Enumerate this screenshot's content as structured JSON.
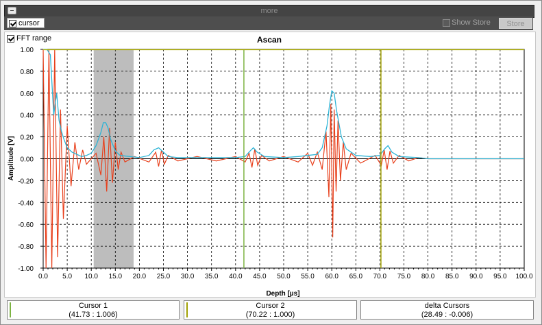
{
  "header": {
    "more_label": "more"
  },
  "toolbar": {
    "cursor_label": "cursor",
    "cursor_checked": true,
    "show_store_label": "Show Store",
    "show_store_checked": false,
    "store_label": "Store"
  },
  "fft_range": {
    "label": "FFT range",
    "checked": true
  },
  "readouts": [
    {
      "title": "Cursor 1",
      "value": "(41.73 : 1.006)",
      "color": "#7cb342"
    },
    {
      "title": "Cursor 2",
      "value": "(70.22 : 1.000)",
      "color": "#a0a000"
    },
    {
      "title": "delta Cursors",
      "value": "(28.49 : -0.006)"
    }
  ],
  "colors": {
    "signal": "#e8401c",
    "envelope": "#2db4d6",
    "cursor1": "#7cb342",
    "cursor2": "#a0a000",
    "fft_band": "#bdbdbd"
  },
  "chart_data": {
    "type": "line",
    "title": "Ascan",
    "xlabel": "Depth [µs]",
    "ylabel": "Amplitude [V]",
    "xlim": [
      0,
      100
    ],
    "ylim": [
      -1,
      1
    ],
    "x_ticks": [
      "0.0",
      "5.0",
      "10.0",
      "15.0",
      "20.0",
      "25.0",
      "30.0",
      "35.0",
      "40.0",
      "45.0",
      "50.0",
      "55.0",
      "60.0",
      "65.0",
      "70.0",
      "75.0",
      "80.0",
      "85.0",
      "90.0",
      "95.0",
      "100.0"
    ],
    "y_ticks": [
      "1.00",
      "0.80",
      "0.60",
      "0.40",
      "0.20",
      "0.00",
      "-0.20",
      "-0.40",
      "-0.60",
      "-0.80",
      "-1.00"
    ],
    "grid": true,
    "fft_range": [
      10.5,
      18.8
    ],
    "cursors": [
      41.73,
      70.22
    ],
    "series": [
      {
        "kind": "envelope",
        "x": [
          0,
          0.8,
          1.5,
          2.2,
          2.8,
          3.3,
          3.8,
          4.3,
          5,
          6,
          7,
          8,
          9,
          10,
          11,
          12,
          12.5,
          13,
          13.5,
          14,
          15,
          16,
          18,
          20,
          22,
          23,
          24,
          25,
          26,
          28,
          30,
          35,
          40,
          42,
          43,
          43.7,
          44.5,
          46,
          50,
          53,
          55,
          57,
          58,
          59,
          59.5,
          60,
          60.5,
          61,
          62,
          63,
          65,
          68,
          70,
          71,
          71.7,
          72.5,
          74,
          78,
          80,
          100
        ],
        "y": [
          1,
          1,
          0.95,
          0.4,
          0.6,
          0.35,
          0.25,
          0.18,
          0.1,
          0.06,
          0.04,
          0.02,
          0.03,
          0.05,
          0.12,
          0.24,
          0.33,
          0.33,
          0.28,
          0.18,
          0.07,
          0.03,
          0.02,
          0.01,
          0.03,
          0.08,
          0.1,
          0.06,
          0.02,
          0.01,
          0.01,
          0.01,
          0.01,
          0.02,
          0.07,
          0.1,
          0.06,
          0.02,
          0.01,
          0.02,
          0.03,
          0.04,
          0.1,
          0.3,
          0.48,
          0.62,
          0.6,
          0.44,
          0.2,
          0.09,
          0.03,
          0.02,
          0.03,
          0.09,
          0.12,
          0.06,
          0.02,
          0.01,
          0,
          0
        ]
      },
      {
        "kind": "signal",
        "x": [
          0,
          0.6,
          1.2,
          1.8,
          2.4,
          3,
          3.6,
          4.2,
          5,
          5.8,
          6.6,
          7.4,
          8.2,
          9,
          11,
          12,
          12.6,
          13.2,
          13.8,
          14.4,
          15,
          15.6,
          16.2,
          17,
          19,
          22,
          23.4,
          24,
          24.6,
          25.2,
          26,
          28,
          32,
          36,
          40,
          42,
          42.8,
          43.4,
          44,
          44.6,
          45.4,
          47,
          50,
          53,
          55,
          56,
          57,
          58,
          58.8,
          59.4,
          59.8,
          60.2,
          60.5,
          60.9,
          61.3,
          61.8,
          62.4,
          63,
          64,
          66,
          69,
          70.3,
          70.9,
          71.5,
          72.1,
          72.8,
          74,
          76,
          78,
          80,
          100
        ],
        "y": [
          1,
          -1,
          1,
          -1,
          1,
          -0.9,
          0.45,
          -0.55,
          0.3,
          -0.25,
          0.15,
          -0.1,
          0.08,
          -0.05,
          0.05,
          -0.15,
          0.2,
          -0.3,
          0.28,
          -0.22,
          0.15,
          -0.1,
          0.06,
          -0.03,
          0.02,
          -0.03,
          0.06,
          -0.07,
          0.08,
          -0.05,
          0.03,
          -0.02,
          0.02,
          -0.02,
          0.02,
          -0.03,
          0.05,
          -0.08,
          0.09,
          -0.06,
          0.03,
          -0.02,
          0.02,
          -0.03,
          0.05,
          -0.06,
          0.06,
          -0.1,
          0.25,
          -0.35,
          0.5,
          -0.72,
          0.45,
          -0.3,
          0.35,
          -0.2,
          0.15,
          -0.1,
          0.05,
          -0.04,
          0.03,
          -0.06,
          0.08,
          -0.1,
          0.07,
          -0.04,
          0.03,
          -0.02,
          0.01,
          0,
          0
        ]
      }
    ]
  }
}
